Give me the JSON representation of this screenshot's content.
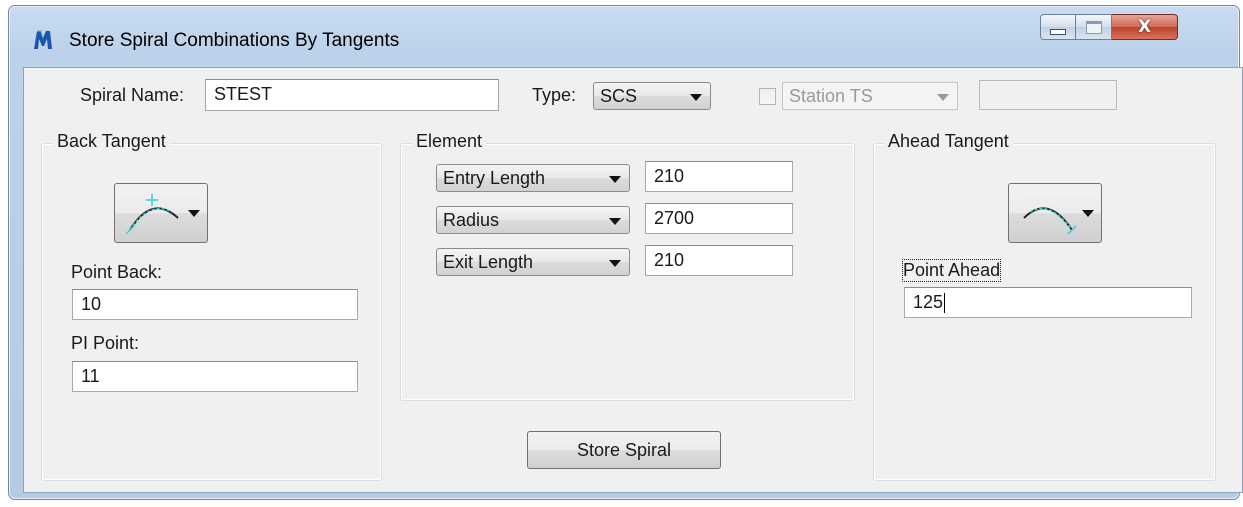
{
  "window": {
    "title": "Store Spiral Combinations By Tangents",
    "close_glyph": "X"
  },
  "header": {
    "spiral_name_label": "Spiral Name:",
    "spiral_name_value": "STEST",
    "type_label": "Type:",
    "type_value": "SCS",
    "station_checked": false,
    "station_value": "Station TS",
    "station_input_value": ""
  },
  "back_tangent": {
    "title": "Back Tangent",
    "icon": "curve-picker-icon",
    "point_back_label": "Point Back:",
    "point_back_value": "10",
    "pi_point_label": "PI Point:",
    "pi_point_value": "11"
  },
  "element": {
    "title": "Element",
    "rows": [
      {
        "param": "Entry Length",
        "value": "210"
      },
      {
        "param": "Radius",
        "value": "2700"
      },
      {
        "param": "Exit Length",
        "value": "210"
      }
    ]
  },
  "ahead_tangent": {
    "title": "Ahead Tangent",
    "icon": "curve-picker-icon",
    "point_ahead_label": "Point Ahead",
    "point_ahead_value": "125"
  },
  "actions": {
    "store_label": "Store Spiral"
  },
  "colors": {
    "titlebar": "#bcd2ea",
    "client_bg": "#f0f0f0",
    "close_button": "#c0422a",
    "curve_accent": "#2fd3d3"
  }
}
